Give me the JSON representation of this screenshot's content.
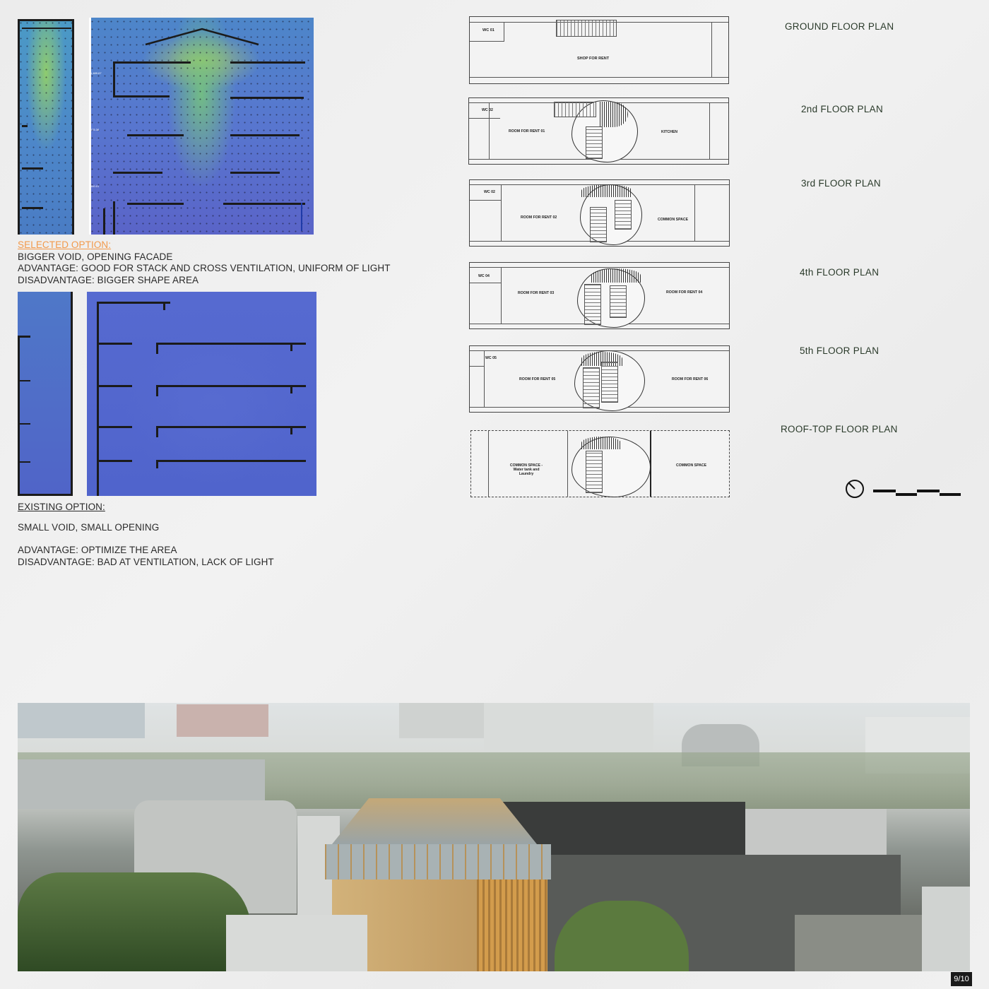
{
  "selected": {
    "heading": "SELECTED OPTION:",
    "line1": "BIGGER VOID, OPENING FACADE",
    "line2": "ADVANTAGE: GOOD FOR STACK AND CROSS VENTILATION, UNIFORM OF LIGHT",
    "line3": "DISADVANTAGE: BIGGER SHAPE AREA"
  },
  "existing": {
    "heading": "EXISTING OPTION:",
    "line1": "SMALL VOID, SMALL OPENING",
    "line2": "ADVANTAGE: OPTIMIZE THE AREA",
    "line3": "DISADVANTAGE: BAD AT VENTILATION, LACK OF LIGHT"
  },
  "plans": [
    {
      "title": "GROUND FLOOR PLAN",
      "rooms": [
        "WC 01",
        "SHOP FOR RENT"
      ]
    },
    {
      "title": "2nd FLOOR PLAN",
      "rooms": [
        "WC 02",
        "ROOM FOR RENT 01",
        "KITCHEN"
      ]
    },
    {
      "title": "3rd FLOOR PLAN",
      "rooms": [
        "WC 02",
        "ROOM FOR RENT 02",
        "COMMON SPACE"
      ]
    },
    {
      "title": "4th FLOOR PLAN",
      "rooms": [
        "WC 04",
        "ROOM FOR RENT 03",
        "ROOM FOR RENT 04"
      ]
    },
    {
      "title": "5th FLOOR PLAN",
      "rooms": [
        "WC 05",
        "ROOM FOR RENT 05",
        "ROOM FOR RENT 06"
      ]
    },
    {
      "title": "ROOF-TOP FLOOR PLAN",
      "rooms": [
        "COMMON SPACE - Water tank and Laundry",
        "COMMON SPACE"
      ]
    }
  ],
  "sim_labels": [
    "1,489.67",
    "975.38",
    "660.01"
  ],
  "page_number": "9/10"
}
